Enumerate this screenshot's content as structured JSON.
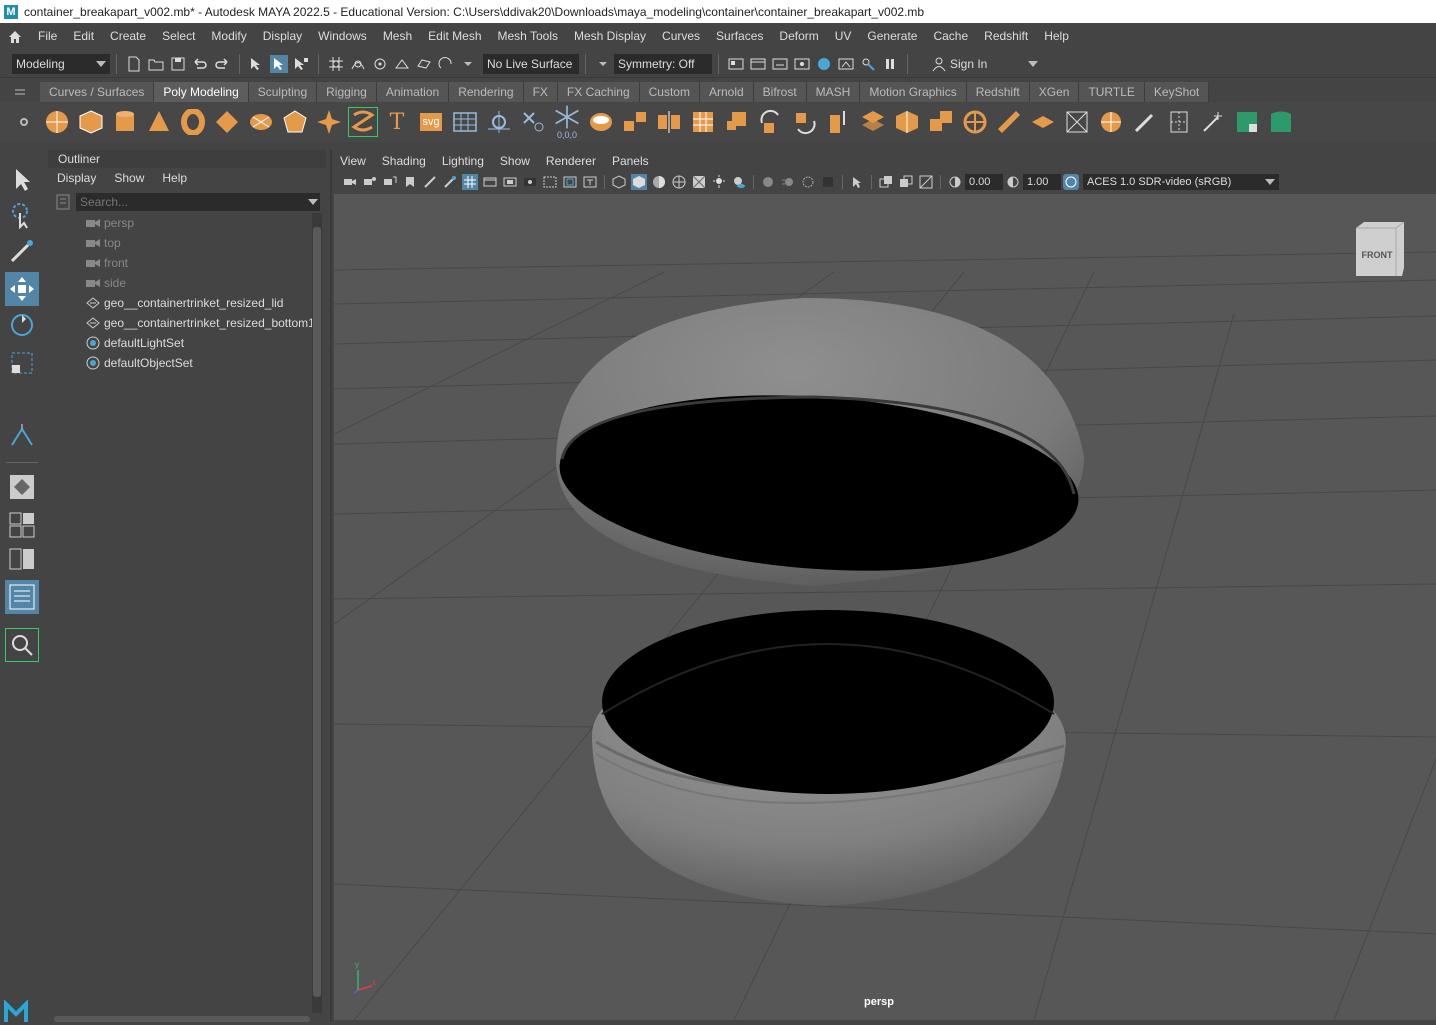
{
  "window": {
    "title": "container_breakapart_v002.mb* - Autodesk MAYA 2022.5 - Educational Version: C:\\Users\\ddivak20\\Downloads\\maya_modeling\\container\\container_breakapart_v002.mb",
    "logo_letter": "M"
  },
  "menubar": {
    "items": [
      "File",
      "Edit",
      "Create",
      "Select",
      "Modify",
      "Display",
      "Windows",
      "Mesh",
      "Edit Mesh",
      "Mesh Tools",
      "Mesh Display",
      "Curves",
      "Surfaces",
      "Deform",
      "UV",
      "Generate",
      "Cache",
      "Redshift",
      "Help"
    ]
  },
  "statusline": {
    "menuset": "Modeling",
    "live_surface": "No Live Surface",
    "symmetry": "Symmetry: Off",
    "sign_in": "Sign In"
  },
  "shelf": {
    "tabs": [
      "Curves / Surfaces",
      "Poly Modeling",
      "Sculpting",
      "Rigging",
      "Animation",
      "Rendering",
      "FX",
      "FX Caching",
      "Custom",
      "Arnold",
      "Bifrost",
      "MASH",
      "Motion Graphics",
      "Redshift",
      "XGen",
      "TURTLE",
      "KeyShot"
    ],
    "active_tab": "Poly Modeling",
    "svg_label": "svg",
    "text_label": "T",
    "coord_label": "0,0,0"
  },
  "outliner": {
    "title": "Outliner",
    "menu": [
      "Display",
      "Show",
      "Help"
    ],
    "search_placeholder": "Search...",
    "items": [
      {
        "label": "persp",
        "type": "camera"
      },
      {
        "label": "top",
        "type": "camera"
      },
      {
        "label": "front",
        "type": "camera"
      },
      {
        "label": "side",
        "type": "camera"
      },
      {
        "label": "geo__containertrinket_resized_lid",
        "type": "mesh"
      },
      {
        "label": "geo__containertrinket_resized_bottom1",
        "type": "mesh"
      },
      {
        "label": "defaultLightSet",
        "type": "set"
      },
      {
        "label": "defaultObjectSet",
        "type": "set"
      }
    ]
  },
  "viewport": {
    "menu": [
      "View",
      "Shading",
      "Lighting",
      "Show",
      "Renderer",
      "Panels"
    ],
    "exposure": "0.00",
    "gamma": "1.00",
    "color_space": "ACES 1.0 SDR-video (sRGB)",
    "camera_label": "persp",
    "viewcube_label": "FRONT",
    "axis_y": "y",
    "axis_x": "x"
  },
  "colors": {
    "accent": "#5285a6",
    "shelf_orange": "#e59a4a",
    "viewport_bg": "#575757"
  }
}
